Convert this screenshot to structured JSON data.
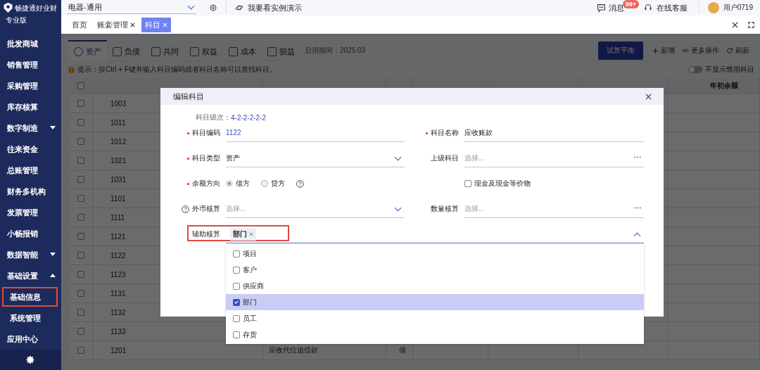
{
  "sidebar": {
    "logo_text": "畅捷通好业财",
    "edition": "专业版",
    "items": [
      {
        "label": "批发商城",
        "kind": "link",
        "highlighted": false
      },
      {
        "label": "销售管理",
        "kind": "link",
        "highlighted": false
      },
      {
        "label": "采购管理",
        "kind": "link",
        "highlighted": false
      },
      {
        "label": "库存核算",
        "kind": "link",
        "highlighted": false
      },
      {
        "label": "数字制造",
        "kind": "group",
        "expanded": false,
        "highlighted": false
      },
      {
        "label": "往来资金",
        "kind": "link",
        "highlighted": false
      },
      {
        "label": "总账管理",
        "kind": "link",
        "highlighted": false
      },
      {
        "label": "财务多机构",
        "kind": "link",
        "highlighted": false
      },
      {
        "label": "发票管理",
        "kind": "link",
        "highlighted": false
      },
      {
        "label": "小畅报销",
        "kind": "link",
        "highlighted": false
      },
      {
        "label": "数据智能",
        "kind": "group",
        "expanded": false,
        "highlighted": false
      },
      {
        "label": "基础设置",
        "kind": "group",
        "expanded": true,
        "highlighted": false
      },
      {
        "label": "基础信息",
        "kind": "sub",
        "highlighted": true
      },
      {
        "label": "系统管理",
        "kind": "sub",
        "highlighted": false
      },
      {
        "label": "应用中心",
        "kind": "link",
        "highlighted": false
      }
    ]
  },
  "top_bar": {
    "account_set": "电器-通用",
    "demo_link": "我要看实例演示",
    "messages": {
      "label": "消息",
      "badge": "99+"
    },
    "support": "在线客服",
    "user": "用户0719"
  },
  "page_tabs": [
    {
      "label": "首页",
      "closable": false,
      "selected": false
    },
    {
      "label": "账套管理",
      "closable": true,
      "selected": false
    },
    {
      "label": "科目",
      "closable": true,
      "selected": true
    }
  ],
  "categories": [
    {
      "label": "资产",
      "selected": true
    },
    {
      "label": "负债",
      "selected": false
    },
    {
      "label": "共同",
      "selected": false
    },
    {
      "label": "权益",
      "selected": false
    },
    {
      "label": "成本",
      "selected": false
    },
    {
      "label": "损益",
      "selected": false
    }
  ],
  "period": "启用期间：2025.03",
  "actions": {
    "primary": "试算平衡",
    "buttons": [
      {
        "label": "新增",
        "kind": "add"
      },
      {
        "label": "更多操作",
        "kind": "more"
      },
      {
        "label": "刷新",
        "kind": "refresh"
      }
    ]
  },
  "hint": "提示：按Ctrl + F键并输入科目编码或者科目名称可以查找科目。",
  "hide_disabled": {
    "label": "不显示禁用科目",
    "on": false
  },
  "table": {
    "columns": [
      {
        "label": "年初余额"
      }
    ],
    "header_checked": false,
    "rows": [
      {
        "code": "1003",
        "checked": false
      },
      {
        "code": "1011",
        "checked": false
      },
      {
        "code": "1012",
        "checked": false
      },
      {
        "code": "1021",
        "checked": false
      },
      {
        "code": "1031",
        "checked": false
      },
      {
        "code": "1101",
        "checked": false
      },
      {
        "code": "1111",
        "checked": false
      },
      {
        "code": "1121",
        "checked": false
      },
      {
        "code": "1122",
        "checked": false
      },
      {
        "code": "1123",
        "checked": false
      },
      {
        "code": "1131",
        "checked": false
      },
      {
        "code": "1132",
        "checked": false
      },
      {
        "code": "1133",
        "checked": false
      },
      {
        "code": "1201",
        "checked": false,
        "name": "应收代位追偿款",
        "direction": "借"
      }
    ]
  },
  "dialog": {
    "title": "编辑科目",
    "level": {
      "label": "科目级次：",
      "value": "4-2-2-2-2-2"
    },
    "fields": [
      {
        "kind": "code",
        "label": "科目编码",
        "required": true,
        "value": "1122"
      },
      {
        "kind": "text",
        "label": "科目名称",
        "required": true,
        "value": "应收账款"
      },
      {
        "kind": "select",
        "label": "科目类型",
        "required": true,
        "value": "资产"
      },
      {
        "kind": "picker",
        "label": "上级科目",
        "required": false,
        "placeholder": "选择..."
      },
      {
        "kind": "radio",
        "label": "余额方向",
        "required": true,
        "help": true,
        "options": [
          {
            "label": "借方",
            "selected": true
          },
          {
            "label": "贷方",
            "selected": false
          }
        ]
      },
      {
        "kind": "checkbox",
        "label": "现金及现金等价物",
        "checked": false
      },
      {
        "kind": "select",
        "label": "外币核算",
        "required": false,
        "help": true,
        "placeholder": "选择..."
      },
      {
        "kind": "picker",
        "label": "数量核算",
        "required": false,
        "placeholder": "选择..."
      },
      {
        "kind": "tags",
        "label": "辅助核算",
        "required": false,
        "highlighted": true,
        "expanded": true,
        "tags": [
          "部门"
        ],
        "options": [
          {
            "label": "项目",
            "checked": false
          },
          {
            "label": "客户",
            "checked": false
          },
          {
            "label": "供应商",
            "checked": false
          },
          {
            "label": "部门",
            "checked": true
          },
          {
            "label": "员工",
            "checked": false
          },
          {
            "label": "存货",
            "checked": false
          }
        ]
      }
    ]
  }
}
